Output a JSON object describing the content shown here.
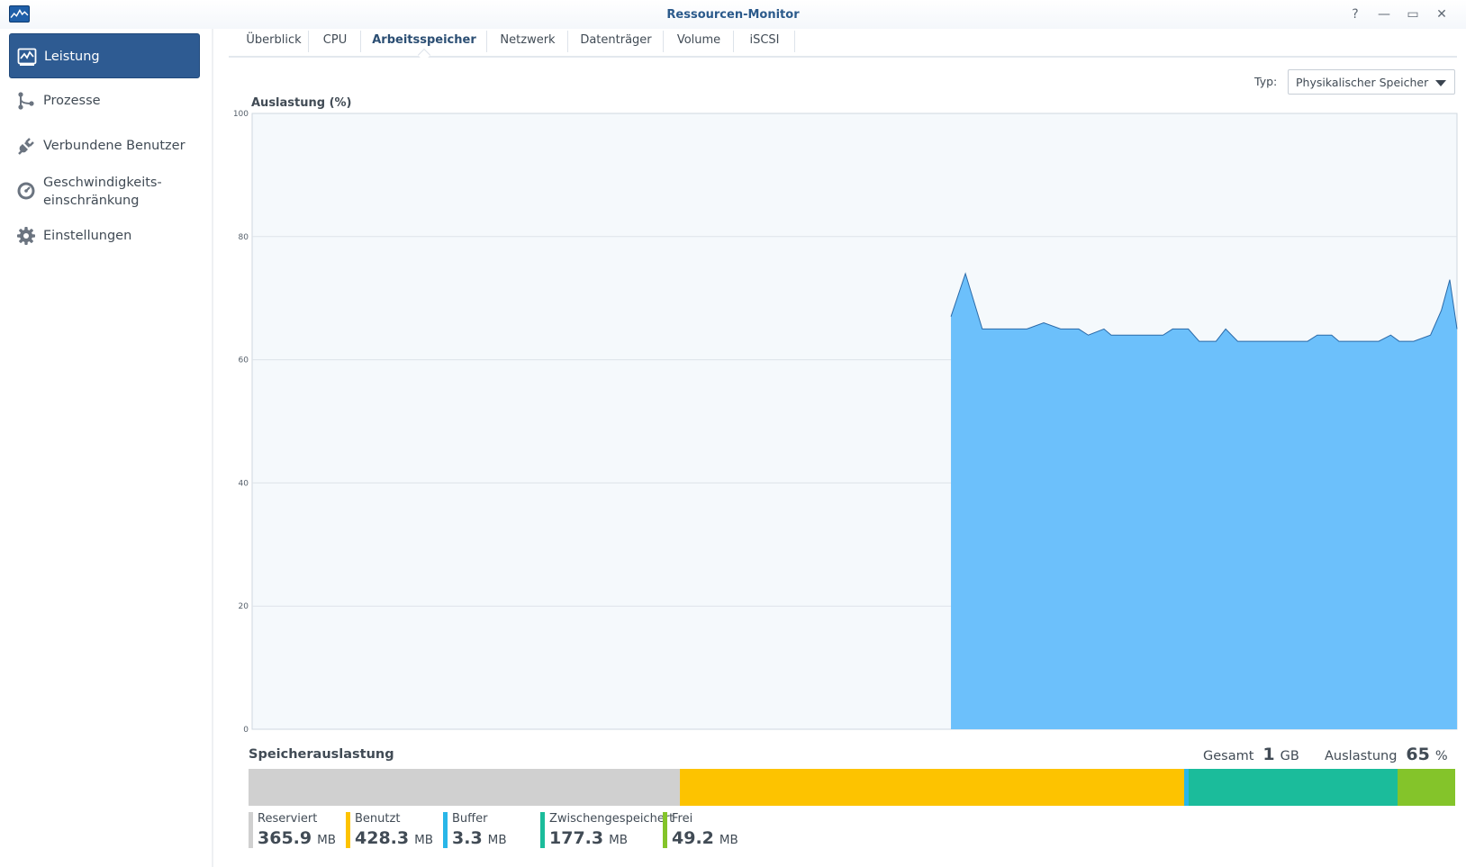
{
  "window": {
    "title": "Ressourcen-Monitor",
    "buttons": {
      "help": "?",
      "minimize": "—",
      "maximize": "▭",
      "close": "✕"
    }
  },
  "sidebar": {
    "items": [
      {
        "label": "Leistung",
        "icon": "performance-chart-icon",
        "active": true
      },
      {
        "label": "Prozesse",
        "icon": "process-nodes-icon",
        "active": false
      },
      {
        "label": "Verbundene Benutzer",
        "icon": "plug-icon",
        "active": false
      },
      {
        "label": "Geschwindigkeits-\neinschränkung",
        "icon": "speedometer-icon",
        "active": false
      },
      {
        "label": "Einstellungen",
        "icon": "gear-icon",
        "active": false
      }
    ]
  },
  "tabs": [
    {
      "label": "Überblick"
    },
    {
      "label": "CPU"
    },
    {
      "label": "Arbeitsspeicher",
      "active": true
    },
    {
      "label": "Netzwerk"
    },
    {
      "label": "Datenträger"
    },
    {
      "label": "Volume"
    },
    {
      "label": "iSCSI"
    }
  ],
  "type_selector": {
    "label": "Typ:",
    "value": "Physikalischer Speicher"
  },
  "chart_data": {
    "type": "area",
    "ylabel": "Auslastung (%)",
    "ylim": [
      0,
      100
    ],
    "yticks": [
      0,
      20,
      40,
      60,
      80,
      100
    ],
    "grid": true,
    "x_range": [
      0,
      100
    ],
    "x": [
      58.0,
      59.2,
      60.6,
      62.8,
      64.3,
      65.7,
      67.1,
      68.6,
      69.4,
      70.7,
      71.3,
      72.4,
      73.4,
      75.6,
      76.4,
      77.7,
      78.6,
      80.0,
      80.8,
      81.8,
      83.0,
      84.9,
      86.4,
      87.6,
      88.4,
      89.6,
      90.2,
      92.1,
      93.5,
      94.5,
      95.2,
      96.4,
      97.8,
      98.7,
      99.4,
      100.0
    ],
    "values": [
      67,
      74,
      65,
      65,
      65,
      66,
      65,
      65,
      64,
      65,
      64,
      64,
      64,
      64,
      65,
      65,
      63,
      63,
      65,
      63,
      63,
      63,
      63,
      63,
      64,
      64,
      63,
      63,
      63,
      64,
      63,
      63,
      64,
      68,
      73,
      65
    ],
    "fill_color": "#6cc0fb",
    "line_color": "#2b6aa8"
  },
  "memory": {
    "title": "Speicherauslastung",
    "total_label": "Gesamt",
    "total_value": "1",
    "total_unit": "GB",
    "usage_label": "Auslastung",
    "usage_value": "65",
    "usage_unit": "%",
    "segments": [
      {
        "name": "Reserviert",
        "value": "365.9",
        "unit": "MB",
        "mb": 365.9,
        "color": "#d0d0d0"
      },
      {
        "name": "Benutzt",
        "value": "428.3",
        "unit": "MB",
        "mb": 428.3,
        "color": "#fdc300"
      },
      {
        "name": "Buffer",
        "value": "3.3",
        "unit": "MB",
        "mb": 3.3,
        "color": "#29b6e8"
      },
      {
        "name": "Zwischengespeichert",
        "value": "177.3",
        "unit": "MB",
        "mb": 177.3,
        "color": "#1bbc9b"
      },
      {
        "name": "Frei",
        "value": "49.2",
        "unit": "MB",
        "mb": 49.2,
        "color": "#84c42a"
      }
    ]
  }
}
